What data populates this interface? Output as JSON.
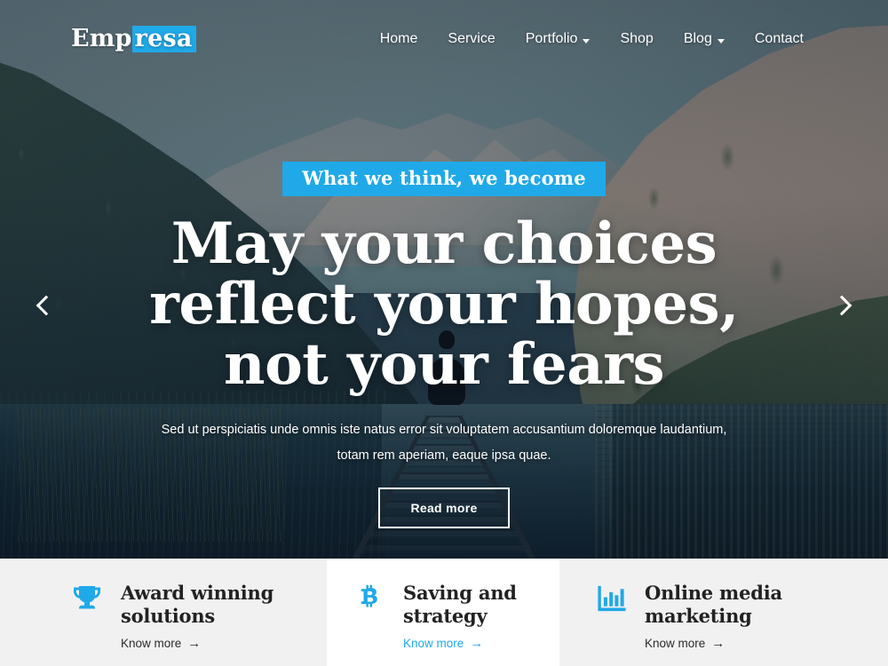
{
  "header": {
    "logo_part1": "Emp",
    "logo_part2": "resa",
    "nav": [
      {
        "label": "Home",
        "icon": "",
        "has_caret": false
      },
      {
        "label": "Service",
        "icon": "",
        "has_caret": false
      },
      {
        "label": "Portfolio",
        "icon": "chevron-down-icon",
        "has_caret": true
      },
      {
        "label": "Shop",
        "icon": "",
        "has_caret": false
      },
      {
        "label": "Blog",
        "icon": "chevron-down-icon",
        "has_caret": true
      },
      {
        "label": "Contact",
        "icon": "",
        "has_caret": false
      }
    ]
  },
  "hero": {
    "badge": "What we think, we become",
    "title": "May your choices reflect your hopes, not your fears",
    "subtitle": "Sed ut perspiciatis unde omnis iste natus error sit voluptatem accusantium doloremque laudantium, totam rem aperiam, eaque ipsa quae.",
    "cta_label": "Read more",
    "prev_icon": "chevron-left-icon",
    "next_icon": "chevron-right-icon",
    "scene": "mountain lake with wooden pier and seated silhouette"
  },
  "features": [
    {
      "icon": "trophy-icon",
      "title": "Award winning\nsolutions",
      "link_label": "Know more",
      "link_arrow": "→",
      "highlighted": false
    },
    {
      "icon": "bitcoin-icon",
      "title": "Saving and\nstrategy",
      "link_label": "Know more",
      "link_arrow": "→",
      "highlighted": true
    },
    {
      "icon": "bar-chart-icon",
      "title": "Online media\nmarketing",
      "link_label": "Know more",
      "link_arrow": "→",
      "highlighted": false
    }
  ],
  "colors": {
    "accent": "#20a9e8",
    "card_bg": "#f1f1f1",
    "card_bg_active": "#ffffff",
    "text_dark": "#222222",
    "text_light": "#ffffff"
  }
}
